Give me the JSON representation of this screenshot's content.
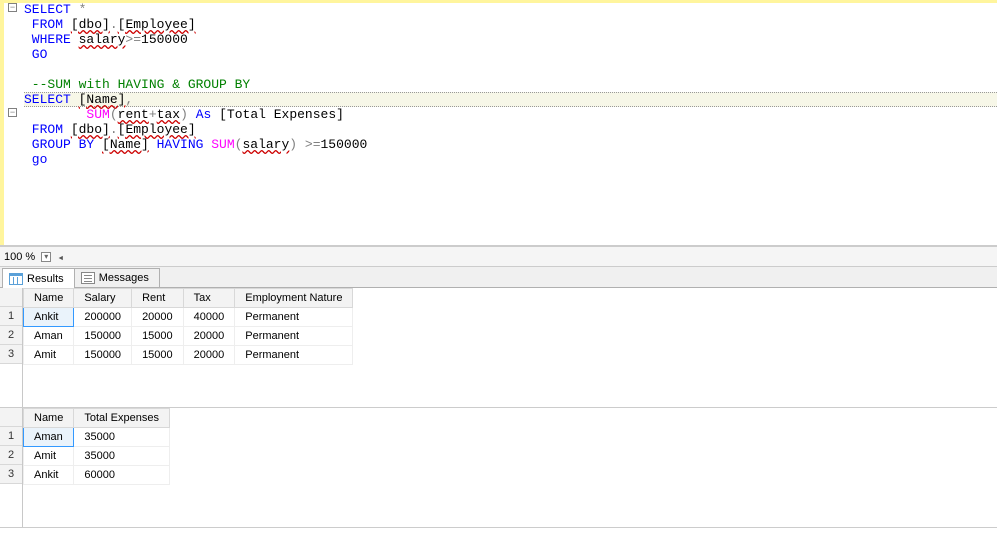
{
  "editor": {
    "l1a": "SELECT",
    "l1b": " *",
    "l2a": " FROM ",
    "l2b": "[dbo]",
    "l2c": ".",
    "l2d": "[Employee]",
    "l3a": " WHERE ",
    "l3b": "salary",
    "l3c": ">=",
    "l3d": "150000",
    "l4": " GO",
    "l5": "",
    "l6": " --SUM with HAVING & GROUP BY",
    "l7a": "SELECT ",
    "l7b": "[Name]",
    "l7c": ",",
    "l8a": "        ",
    "l8b": "SUM",
    "l8c": "(",
    "l8d": "rent",
    "l8e": "+",
    "l8f": "tax",
    "l8g": ")",
    "l8h": " As ",
    "l8i": "[Total Expenses]",
    "l9a": " FROM ",
    "l9b": "[dbo]",
    "l9c": ".",
    "l9d": "[Employee]",
    "l10a": " GROUP BY ",
    "l10b": "[Name]",
    "l10c": " HAVING ",
    "l10d": "SUM",
    "l10e": "(",
    "l10f": "salary",
    "l10g": ")",
    "l10h": " >=",
    "l10i": "150000",
    "l11": " go"
  },
  "zoom": "100 %",
  "tabs": {
    "results": "Results",
    "messages": "Messages"
  },
  "grid1": {
    "headers": [
      "Name",
      "Salary",
      "Rent",
      "Tax",
      "Employment Nature"
    ],
    "rows": [
      [
        "Ankit",
        "200000",
        "20000",
        "40000",
        "Permanent"
      ],
      [
        "Aman",
        "150000",
        "15000",
        "20000",
        "Permanent"
      ],
      [
        "Amit",
        "150000",
        "15000",
        "20000",
        "Permanent"
      ]
    ],
    "rownums": [
      "1",
      "2",
      "3"
    ]
  },
  "grid2": {
    "headers": [
      "Name",
      "Total Expenses"
    ],
    "rows": [
      [
        "Aman",
        "35000"
      ],
      [
        "Amit",
        "35000"
      ],
      [
        "Ankit",
        "60000"
      ]
    ],
    "rownums": [
      "1",
      "2",
      "3"
    ]
  }
}
